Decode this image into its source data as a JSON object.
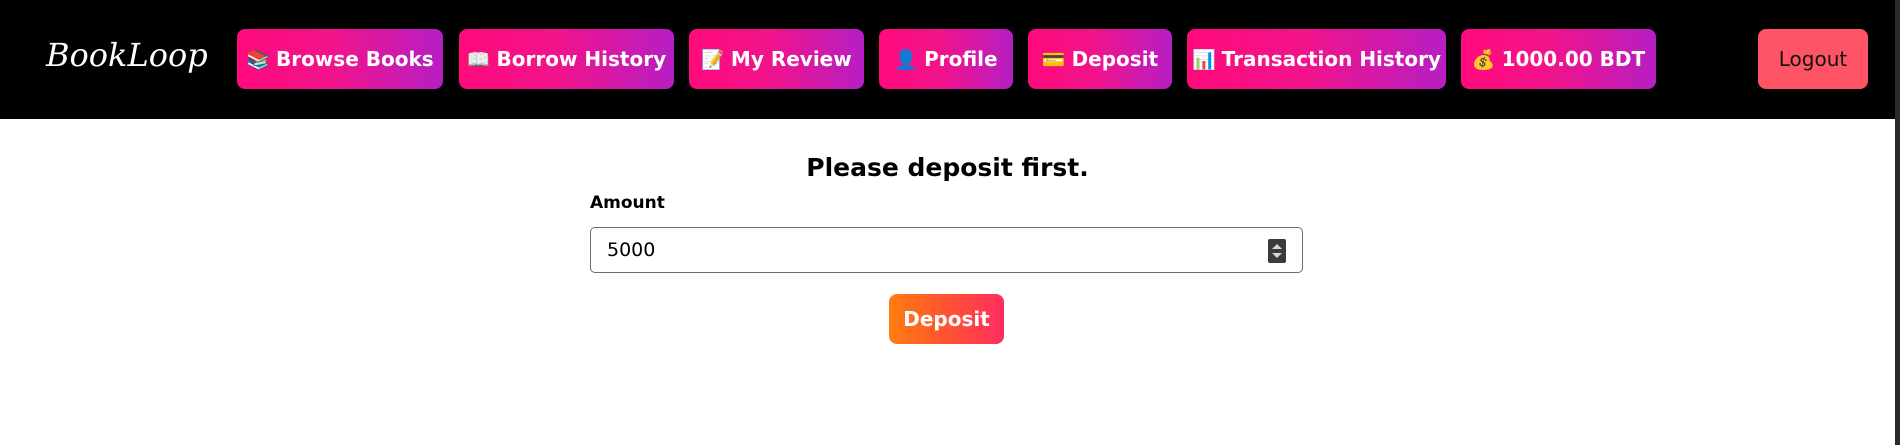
{
  "brand": {
    "logo_text": "BookLoop"
  },
  "nav": {
    "items": [
      {
        "icon": "📚",
        "icon_name": "books-icon",
        "label": "Browse Books"
      },
      {
        "icon": "📖",
        "icon_name": "open-book-icon",
        "label": "Borrow History"
      },
      {
        "icon": "📝",
        "icon_name": "memo-icon",
        "label": "My Review"
      },
      {
        "icon": "👤",
        "icon_name": "user-icon",
        "label": "Profile"
      },
      {
        "icon": "💳",
        "icon_name": "credit-card-icon",
        "label": "Deposit"
      },
      {
        "icon": "📊",
        "icon_name": "bar-chart-icon",
        "label": "Transaction History"
      },
      {
        "icon": "💰",
        "icon_name": "money-bag-icon",
        "label": "1000.00 BDT"
      }
    ],
    "logout_label": "Logout"
  },
  "main": {
    "heading": "Please deposit first.",
    "amount_label": "Amount",
    "amount_value": "5000",
    "deposit_label": "Deposit"
  },
  "colors": {
    "navbar_bg": "#000000",
    "nav_button_gradient_start": "#ff0a7c",
    "nav_button_gradient_end": "#b61ec4",
    "logout_bg": "#ff5465",
    "deposit_gradient_start": "#ff7d10",
    "deposit_gradient_end": "#ff2d5f"
  }
}
